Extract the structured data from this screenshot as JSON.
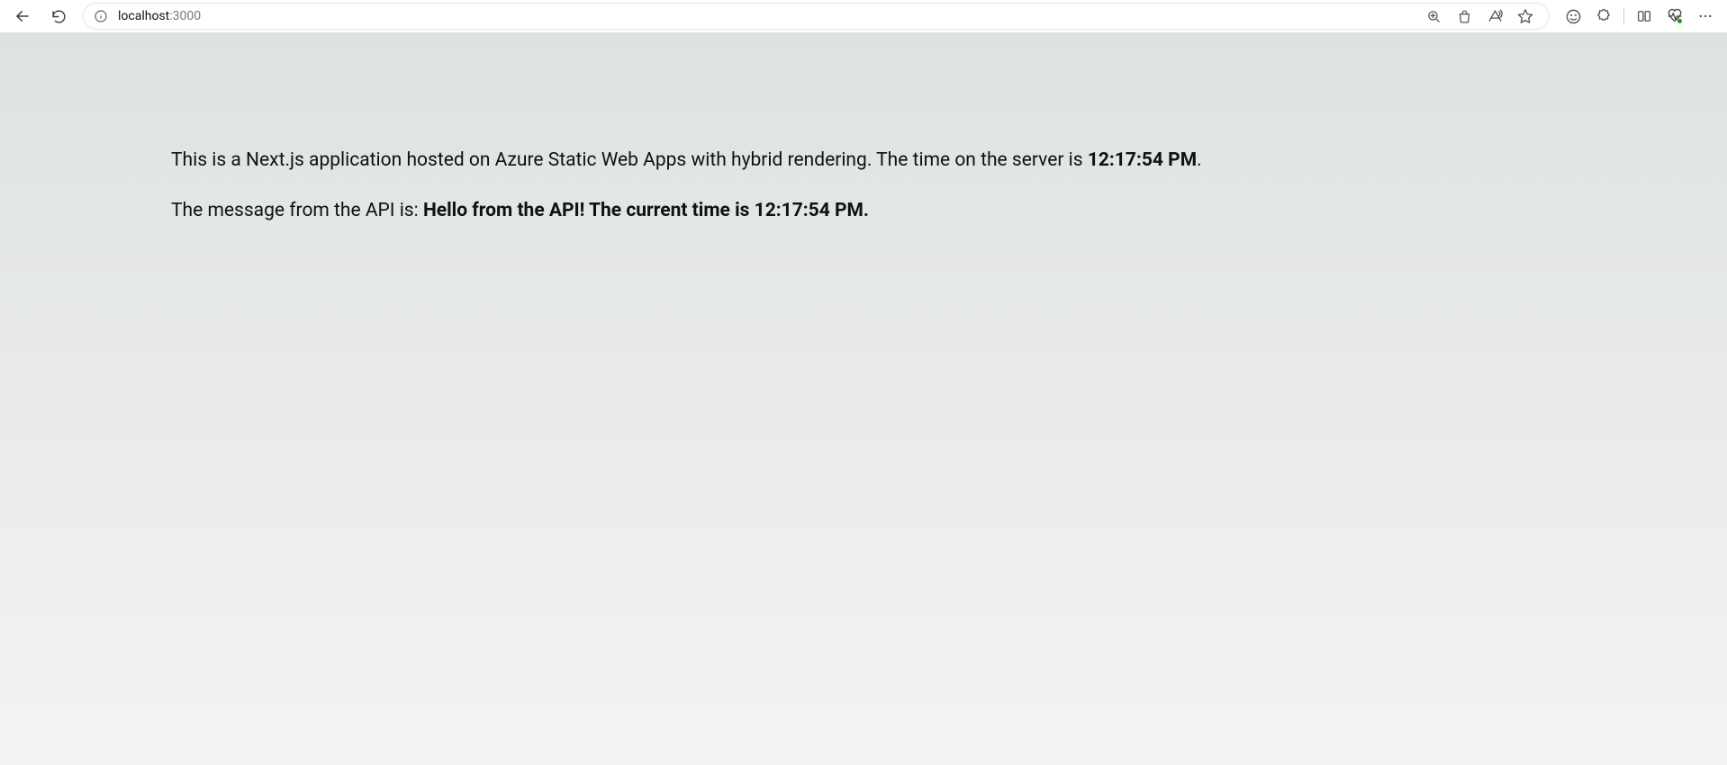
{
  "browser": {
    "url_host": "localhost",
    "url_port": ":3000"
  },
  "page": {
    "p1_prefix": "This is a Next.js application hosted on Azure Static Web Apps with hybrid rendering. The time on the server is ",
    "p1_time": "12:17:54 PM",
    "p1_suffix": ".",
    "p2_prefix": "The message from the API is: ",
    "p2_message": "Hello from the API! The current time is 12:17:54 PM."
  }
}
